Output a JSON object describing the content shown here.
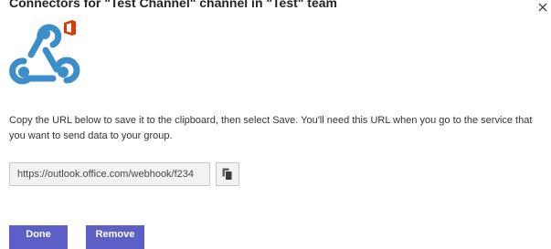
{
  "dialog": {
    "title": "Connectors for \"Test Channel\" channel in \"Test\" team"
  },
  "icons": {
    "close": "close-icon",
    "webhook": "webhook-logo-icon",
    "office": "office-logo-icon",
    "copy": "copy-icon"
  },
  "colors": {
    "webhook_blue": "#3c8ec9",
    "office_red": "#d83b01",
    "primary_button": "#5b5fc7"
  },
  "instructions": "Copy the URL below to save it to the clipboard, then select Save. You'll need this URL when you go to the service that you want to send data to your group.",
  "url_field": {
    "value": "https://outlook.office.com/webhook/f234"
  },
  "buttons": {
    "done": "Done",
    "remove": "Remove"
  }
}
